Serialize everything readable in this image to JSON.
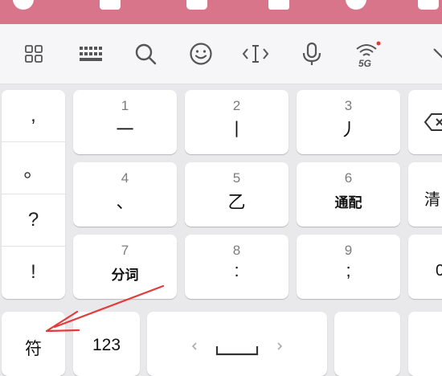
{
  "toolbar": {
    "icons": [
      "apps-grid-icon",
      "keyboard-icon",
      "search-icon",
      "emoji-icon",
      "cursor-move-icon",
      "microphone-icon",
      "wifi-5g-icon",
      "chevron-down-icon"
    ],
    "badge_5g": "5G"
  },
  "symbols_column": [
    ",",
    "。",
    "?",
    "!"
  ],
  "keys": [
    {
      "num": "1",
      "label": "一"
    },
    {
      "num": "2",
      "label": "丨"
    },
    {
      "num": "3",
      "label": "丿"
    },
    {
      "num": "4",
      "label": "、"
    },
    {
      "num": "5",
      "label": "乙"
    },
    {
      "num": "6",
      "label": "通配"
    },
    {
      "num": "7",
      "label": "分词"
    },
    {
      "num": "8",
      "label": ":"
    },
    {
      "num": "9",
      "label": ";"
    }
  ],
  "right_keys": {
    "delete": "backspace-icon",
    "clear_label": "清",
    "zero_label": "0"
  },
  "bottom": {
    "symbol_label": "符",
    "numeric_label": "123"
  },
  "colors": {
    "header_pink": "#d9758a",
    "annotation_red": "#e43a3a"
  }
}
